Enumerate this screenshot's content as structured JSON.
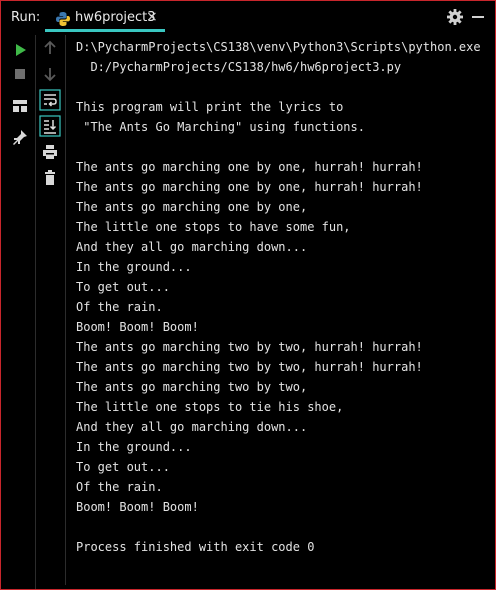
{
  "header": {
    "run_label": "Run:",
    "tab_title": "hw6project3",
    "tab_close": "×"
  },
  "icons": {
    "run": "play-icon",
    "stop": "stop-icon",
    "layout": "layout-icon",
    "pin": "pin-icon",
    "up": "arrow-up-icon",
    "down": "arrow-down-icon",
    "wrap": "soft-wrap-icon",
    "scroll": "scroll-to-end-icon",
    "print": "print-icon",
    "trash": "trash-icon",
    "settings": "gear-icon",
    "minimize": "minimize-icon"
  },
  "colors": {
    "accent": "#3ac7c1",
    "run_green": "#3fb948",
    "frame_red": "#c8262c"
  },
  "console": {
    "lines": [
      "D:\\PycharmProjects\\CS138\\venv\\Python3\\Scripts\\python.exe",
      "  D:/PycharmProjects/CS138/hw6/hw6project3.py",
      "",
      "This program will print the lyrics to",
      " \"The Ants Go Marching\" using functions.",
      "",
      "The ants go marching one by one, hurrah! hurrah!",
      "The ants go marching one by one, hurrah! hurrah!",
      "The ants go marching one by one,",
      "The little one stops to have some fun,",
      "And they all go marching down...",
      "In the ground...",
      "To get out...",
      "Of the rain.",
      "Boom! Boom! Boom!",
      "The ants go marching two by two, hurrah! hurrah!",
      "The ants go marching two by two, hurrah! hurrah!",
      "The ants go marching two by two,",
      "The little one stops to tie his shoe,",
      "And they all go marching down...",
      "In the ground...",
      "To get out...",
      "Of the rain.",
      "Boom! Boom! Boom!",
      "",
      "Process finished with exit code 0"
    ]
  }
}
